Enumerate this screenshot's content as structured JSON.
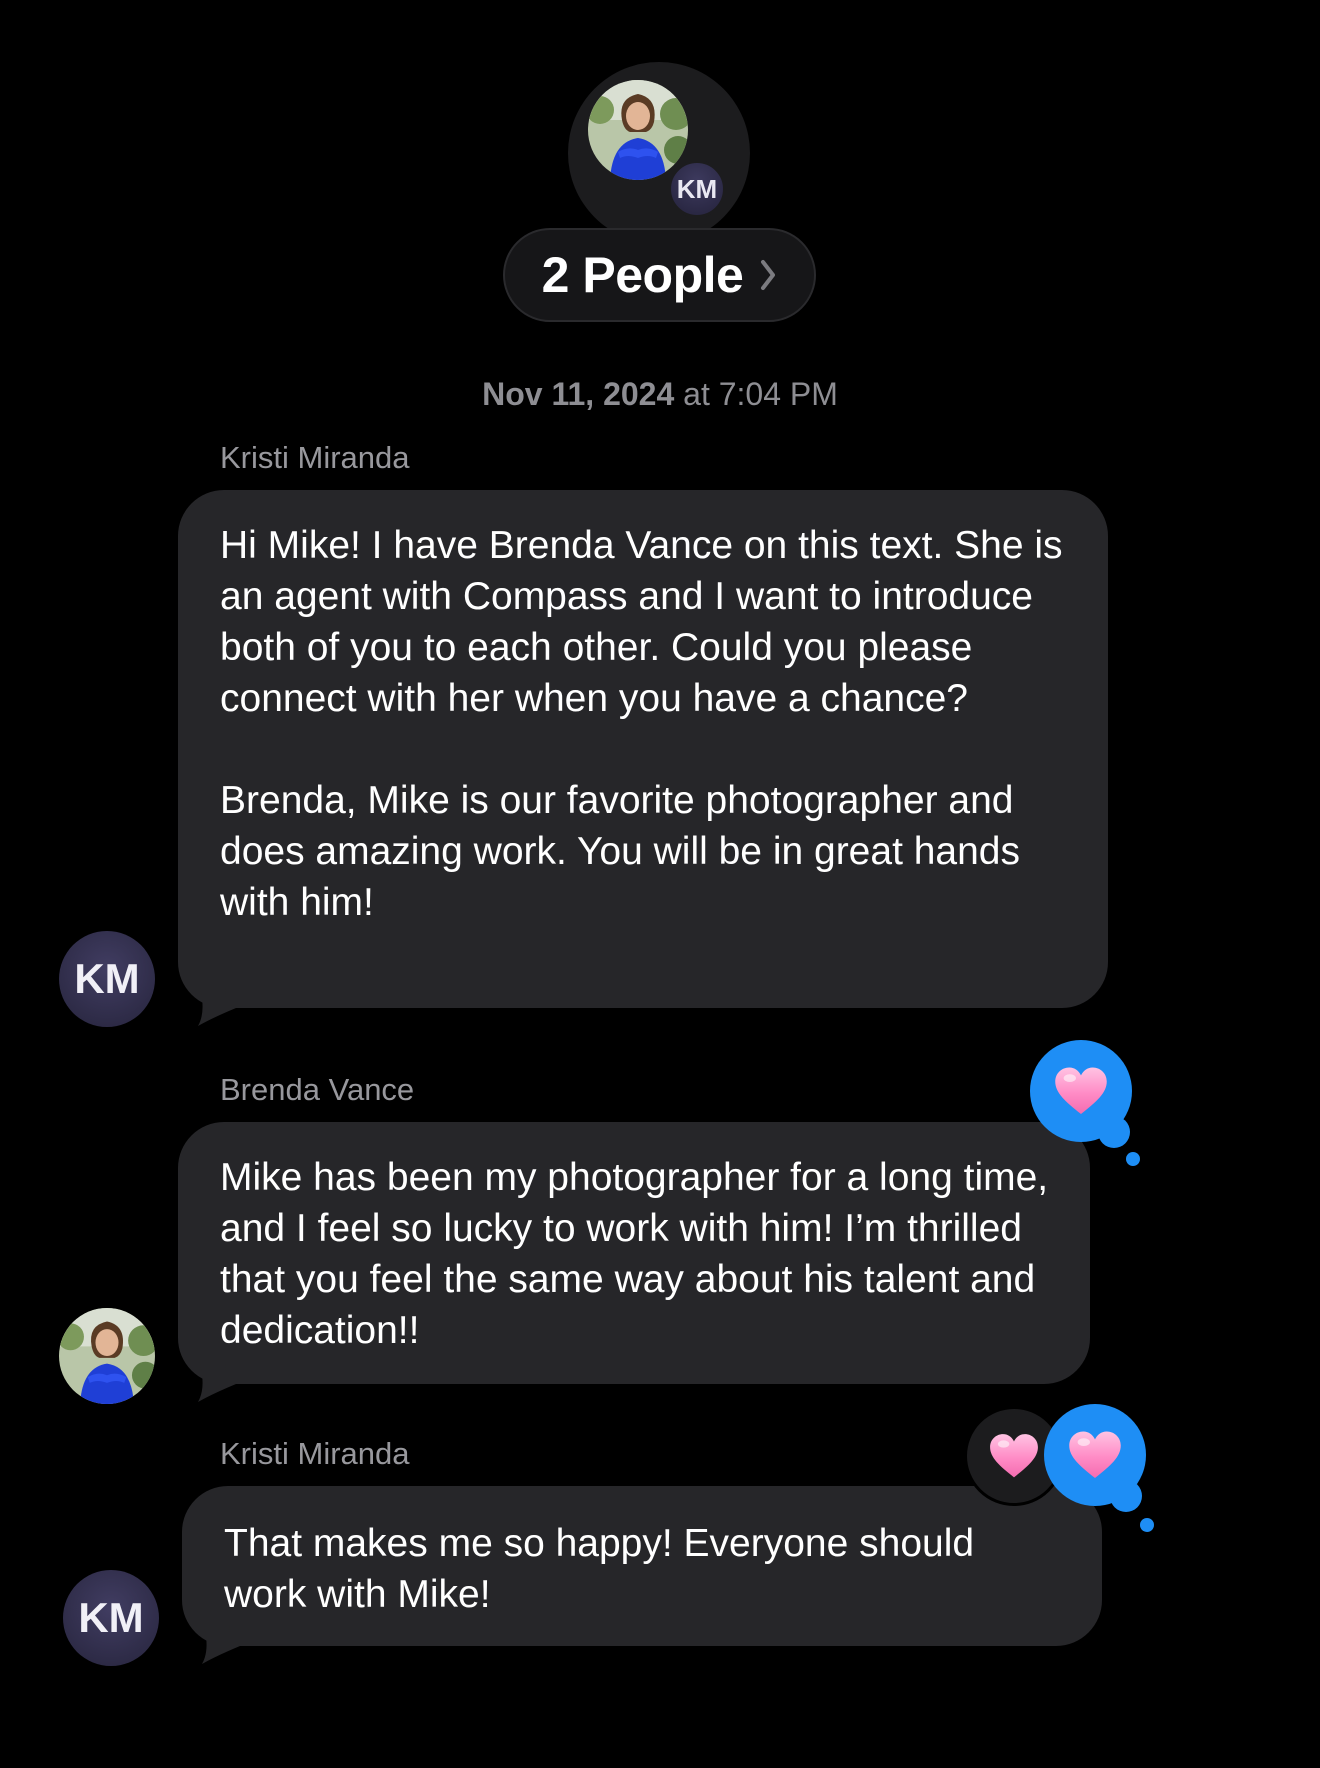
{
  "header": {
    "group_initials": "KM",
    "people_label": "2 People"
  },
  "timestamp": {
    "date": "Nov 11, 2024",
    "time": "at 7:04 PM"
  },
  "messages": [
    {
      "sender": "Kristi Miranda",
      "avatar_initials": "KM",
      "text": "Hi Mike! I have Brenda Vance on this text. She is an agent with Compass and I want to introduce both of you to each other. Could you please connect with her when you have a chance?\n\nBrenda, Mike is our favorite photographer and does amazing work. You will be in great hands with him!"
    },
    {
      "sender": "Brenda Vance",
      "text": "Mike has been my photographer for a long time, and I feel so lucky to work with him! I’m thrilled that you feel the same way about his talent and dedication!!",
      "reaction": "heart-icon"
    },
    {
      "sender": "Kristi Miranda",
      "avatar_initials": "KM",
      "text": "That makes me so happy! Everyone should work with Mike!",
      "reactions": [
        "heart-icon",
        "heart-icon"
      ]
    }
  ],
  "colors": {
    "background": "#000000",
    "bubble": "#262629",
    "tapback_blue": "#1e8ef5",
    "heart_pink": "#ff8fc8"
  }
}
